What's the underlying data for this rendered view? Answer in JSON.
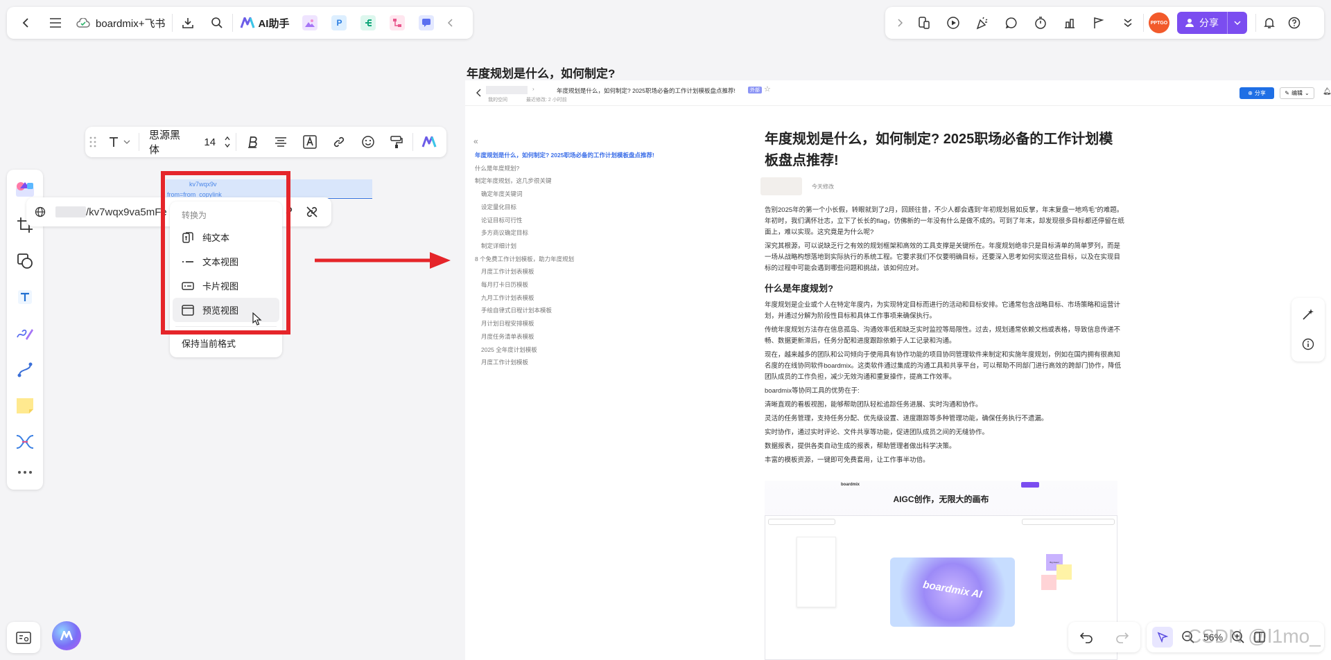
{
  "app": {
    "title": "boardmix+飞书",
    "ai_label": "AI助手",
    "share_label": "分享",
    "avatar_text": "PPTGO",
    "accent": "#7b4df0"
  },
  "format_toolbar": {
    "font": "思源黑体",
    "size": "14"
  },
  "link_bar": {
    "url": "/kv7wqx9va5mFe"
  },
  "selected_text": {
    "line1": "kv7wqx9v",
    "line2": "from=from_copylink"
  },
  "convert_menu": {
    "title": "转换为",
    "items": [
      "纯文本",
      "文本视图",
      "卡片视图",
      "预览视图"
    ],
    "keep": "保持当前格式"
  },
  "preview": {
    "heading": "年度规划是什么，如何制定?",
    "topbar": {
      "breadcrumb": "年度规划是什么，如何制定? 2025职场必备的工作计划模板盘点推荐!",
      "tag": "外部",
      "space": "我的空间",
      "edited": "最近修改: 2 小时前",
      "share": "分享",
      "edit": "编辑"
    },
    "toc": [
      "年度规划是什么，如何制定? 2025职场必备的工作计划模板盘点推荐!",
      "什么是年度规划?",
      "制定年度规划，这几步很关键",
      "确定年度关键词",
      "设定量化目标",
      "论证目标可行性",
      "多方商议确定目标",
      "制定详细计划",
      "8 个免费工作计划模板，助力年度规划",
      "月度工作计划表模板",
      "每月打卡日历模板",
      "九月工作计划表模板",
      "手绘自律式日程计划本模板",
      "月计划日程安排模板",
      "月度任务清单表模板",
      "2025 全年度计划模板",
      "月度工作计划模板"
    ],
    "article": {
      "title": "年度规划是什么，如何制定? 2025职场必备的工作计划模板盘点推荐!",
      "modified": "今天修改",
      "p1": "告别2025年的第一个小长假，转眼就到了2月，回顾往昔，不少人都会遇到“年初规划易如反掌，年末复盘一地鸡毛”的难题。年初时，我们满怀壮志，立下了长长的flag，仿佛新的一年没有什么是做不成的。可到了年末，却发现很多目标都还停留在纸面上，难以实现。这究竟是为什么呢?",
      "p2": "深究其根源，可以说缺乏行之有效的规划框架和高效的工具支撑是关键所在。年度规划绝非只是目标清单的简单罗列，而是一场从战略构想落地到实际执行的系统工程。它要求我们不仅要明确目标，还要深入思考如何实现这些目标，以及在实现目标的过程中可能会遇到哪些问题和挑战，该如何应对。",
      "h2": "什么是年度规划?",
      "p3": "年度规划是企业或个人在特定年度内，为实现特定目标而进行的活动和目标安排。它通常包含战略目标、市场策略和运营计划，并通过分解为阶段性目标和具体工作事项来确保执行。",
      "p4": "传统年度规划方法存在信息孤岛、沟通效率低和缺乏实时监控等局限性。过去，规划通常依赖文档或表格，导致信息传递不畅、数据更新滞后，任务分配和进度跟踪依赖于人工记录和沟通。",
      "p5": "现在，越来越多的团队和公司倾向于使用具有协作功能的项目协同管理软件来制定和实施年度规划，例如在国内拥有很高知名度的在线协同软件boardmix。这类软件通过集成的沟通工具和共享平台，可以帮助不同部门进行高效的跨部门协作，降低团队成员的工作负担，减少无效沟通和重复操作，提高工作效率。",
      "p6": "boardmix等协同工具的优势在于:",
      "p7": "清晰直观的看板视图，能够帮助团队轻松追踪任务进展、实时沟通和协作。",
      "p8": "灵活的任务管理，支持任务分配、优先级设置、进度跟踪等多种管理功能，确保任务执行不遗漏。",
      "p9": "实时协作，通过实时评论、文件共享等功能，促进团队成员之间的无缝协作。",
      "p10": "数据报表，提供各类自动生成的报表，帮助管理者做出科学决策。",
      "p11": "丰富的模板资源，一键即可免费套用，让工作事半功倍。"
    },
    "banner": {
      "title": "AIGC创作，无限大的画布",
      "brand": "boardmix",
      "art": "boardmix AI",
      "sticky": "Big Ideas!"
    }
  },
  "zoom": {
    "value": "56%"
  },
  "watermark": "CSDN @l1mo_"
}
